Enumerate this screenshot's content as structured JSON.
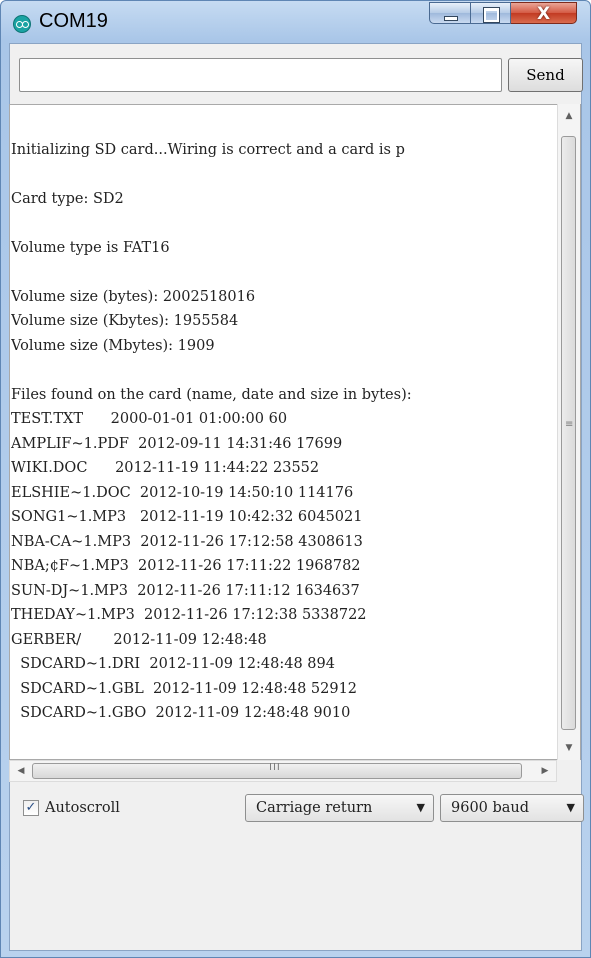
{
  "window": {
    "title": "COM19",
    "icon": "arduino-icon",
    "controls": {
      "minimize": "minimize-icon",
      "maximize": "maximize-icon",
      "close_glyph": "X"
    }
  },
  "send_bar": {
    "input_value": "",
    "send_label": "Send"
  },
  "serial_output": {
    "lines": [
      "",
      "Initializing SD card...Wiring is correct and a card is p",
      "",
      "Card type: SD2",
      "",
      "Volume type is FAT16",
      "",
      "Volume size (bytes): 2002518016",
      "Volume size (Kbytes): 1955584",
      "Volume size (Mbytes): 1909",
      "",
      "Files found on the card (name, date and size in bytes):",
      "TEST.TXT      2000-01-01 01:00:00 60",
      "AMPLIF~1.PDF  2012-09-11 14:31:46 17699",
      "WIKI.DOC      2012-11-19 11:44:22 23552",
      "ELSHIE~1.DOC  2012-10-19 14:50:10 114176",
      "SONG1~1.MP3   2012-11-19 10:42:32 6045021",
      "NBA-CA~1.MP3  2012-11-26 17:12:58 4308613",
      "NBA;¢F~1.MP3  2012-11-26 17:11:22 1968782",
      "SUN-DJ~1.MP3  2012-11-26 17:11:12 1634637",
      "THEDAY~1.MP3  2012-11-26 17:12:38 5338722",
      "GERBER/       2012-11-09 12:48:48",
      "  SDCARD~1.DRI  2012-11-09 12:48:48 894",
      "  SDCARD~1.GBL  2012-11-09 12:48:48 52912",
      "  SDCARD~1.GBO  2012-11-09 12:48:48 9010"
    ]
  },
  "scrollbars": {
    "vertical": {
      "up": "▲",
      "down": "▼",
      "grip": "≡"
    },
    "horizontal": {
      "left": "◀",
      "right": "▶",
      "grip": "III"
    }
  },
  "footer": {
    "autoscroll_label": "Autoscroll",
    "autoscroll_checked": true,
    "line_ending": "Carriage return",
    "baud": "9600 baud",
    "dropdown_arrow": "▼"
  }
}
